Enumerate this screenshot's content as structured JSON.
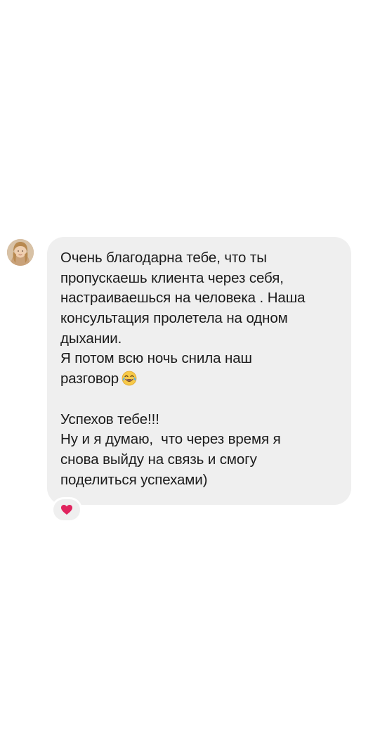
{
  "conversation": {
    "message": {
      "lines": [
        "Очень благодарна тебе, что ты",
        "пропускаешь клиента через себя,",
        "настраиваешься на человека . Наша",
        "консультация пролетела на одном",
        "дыхании.",
        "Я потом всю ночь снила наш",
        "разговор",
        "",
        "Успехов тебе!!!",
        "Ну и я думаю,  что через время я",
        "снова выйду на связь и смогу",
        "поделиться успехами)"
      ],
      "emoji": "face-with-tears-of-joy-icon"
    },
    "reaction": {
      "icon": "heart-icon",
      "color": "#e0245e"
    },
    "colors": {
      "bubble": "#efefef",
      "text": "#1b1b1b",
      "background": "#ffffff"
    }
  }
}
